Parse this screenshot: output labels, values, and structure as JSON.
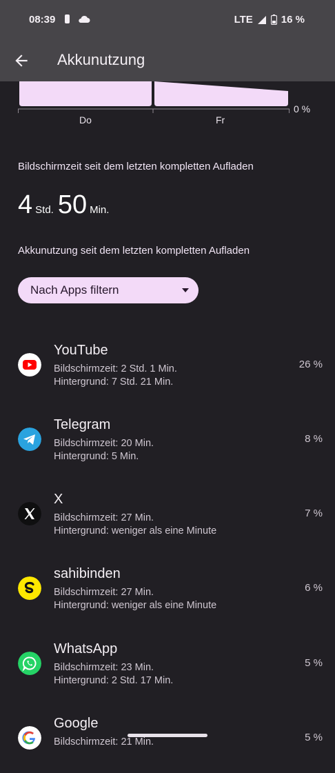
{
  "status": {
    "time": "08:39",
    "network": "LTE",
    "battery": "16 %"
  },
  "header": {
    "title": "Akkunutzung"
  },
  "chart": {
    "days": [
      "Do",
      "Fr"
    ],
    "zero_label": "0 %"
  },
  "screen_time": {
    "label": "Bildschirmzeit seit dem letzten kompletten Aufladen",
    "hours": "4",
    "hours_unit": "Std.",
    "minutes": "50",
    "minutes_unit": "Min."
  },
  "usage": {
    "label": "Akkunutzung seit dem letzten kompletten Aufladen"
  },
  "filter": {
    "label": "Nach Apps filtern"
  },
  "apps": [
    {
      "name": "YouTube",
      "screen": "Bildschirmzeit: 2 Std. 1 Min.",
      "background": "Hintergrund: 7 Std. 21 Min.",
      "percent": "26 %"
    },
    {
      "name": "Telegram",
      "screen": "Bildschirmzeit: 20 Min.",
      "background": "Hintergrund: 5 Min.",
      "percent": "8 %"
    },
    {
      "name": "X",
      "screen": "Bildschirmzeit: 27 Min.",
      "background": "Hintergrund: weniger als eine Minute",
      "percent": "7 %"
    },
    {
      "name": "sahibinden",
      "screen": "Bildschirmzeit: 27 Min.",
      "background": "Hintergrund: weniger als eine Minute",
      "percent": "6 %"
    },
    {
      "name": "WhatsApp",
      "screen": "Bildschirmzeit: 23 Min.",
      "background": "Hintergrund: 2 Std. 17 Min.",
      "percent": "5 %"
    },
    {
      "name": "Google",
      "screen": "Bildschirmzeit: 21 Min.",
      "background": "",
      "percent": "5 %"
    }
  ]
}
